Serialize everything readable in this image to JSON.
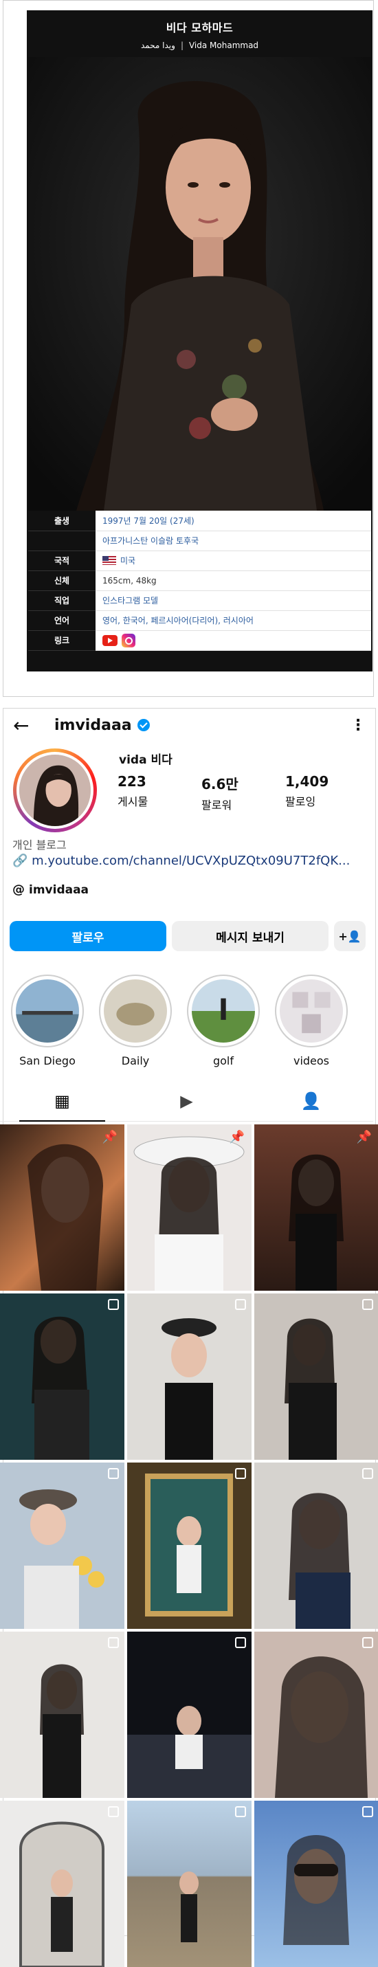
{
  "wiki": {
    "title": "비다 모하마드",
    "subtitle_native": "ویدا محمد",
    "subtitle_latin": "Vida Mohammad",
    "rows": [
      {
        "key": "출생",
        "value": "1997년 7월 20일 (27세)"
      },
      {
        "key": "",
        "value": "아프가니스탄 이슬람 토후국"
      },
      {
        "key": "국적",
        "value": "미국"
      },
      {
        "key": "신체",
        "value": "165cm, 48kg"
      },
      {
        "key": "직업",
        "value": "인스타그램 모델"
      },
      {
        "key": "언어",
        "value": "영어, 한국어, 페르시아어(다리어), 러시아어"
      },
      {
        "key": "링크",
        "value": ""
      }
    ]
  },
  "instagram": {
    "username": "imvidaaa",
    "display_name": "vida 비다",
    "stats": [
      {
        "num": "223",
        "label": "게시물"
      },
      {
        "num": "6.6만",
        "label": "팔로워"
      },
      {
        "num": "1,409",
        "label": "팔로잉"
      }
    ],
    "category": "개인 블로그",
    "link": "m.youtube.com/channel/UCVXpUZQtx09U7T2fQK...",
    "threads": "imvidaaa",
    "follow_label": "팔로우",
    "message_label": "메시지 보내기",
    "highlights": [
      {
        "label": "San Diego"
      },
      {
        "label": "Daily"
      },
      {
        "label": "golf"
      },
      {
        "label": "videos"
      }
    ]
  }
}
